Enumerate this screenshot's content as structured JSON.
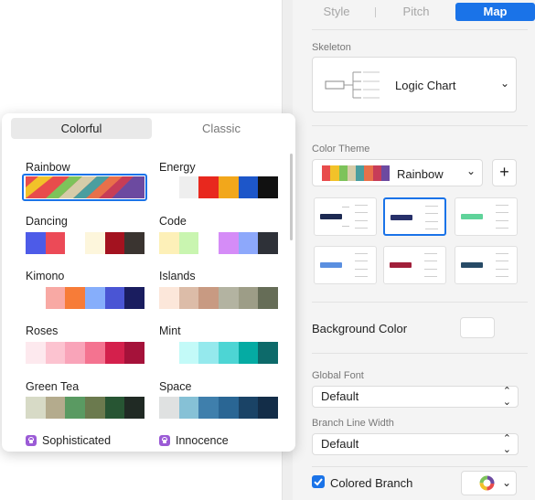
{
  "tabs": [
    {
      "label": "Style"
    },
    {
      "label": "Pitch"
    },
    {
      "label": "Map"
    }
  ],
  "skeleton": {
    "label": "Skeleton",
    "value": "Logic Chart"
  },
  "color_theme": {
    "label": "Color Theme",
    "value": "Rainbow",
    "add_symbol": "+"
  },
  "background_color": {
    "label": "Background Color",
    "value": "#ffffff"
  },
  "global_font": {
    "label": "Global Font",
    "value": "Default"
  },
  "branch_line_width": {
    "label": "Branch Line Width",
    "value": "Default"
  },
  "colored_branch": {
    "label": "Colored Branch",
    "checked": true
  },
  "popup": {
    "segments": [
      {
        "label": "Colorful",
        "active": true
      },
      {
        "label": "Classic",
        "active": false
      }
    ],
    "themes": [
      {
        "name": "Rainbow",
        "colors": [
          "#e84c4c",
          "#f2c229",
          "#7dc35a",
          "#d6cca9",
          "#4a9e9f",
          "#e8704a",
          "#c73d58",
          "#6c4aa0"
        ],
        "selected": true
      },
      {
        "name": "Energy",
        "colors": [
          "#ffffff",
          "#eeeeee",
          "#e8281e",
          "#f2a71b",
          "#1d56c9",
          "#111111"
        ]
      },
      {
        "name": "Dancing",
        "colors": [
          "#4d5be8",
          "#ec4a57",
          "#ffffff",
          "#fdf6dc",
          "#a3121f",
          "#3a3430"
        ]
      },
      {
        "name": "Code",
        "colors": [
          "#fdf0b8",
          "#c9f5b0",
          "#ffffff",
          "#d58cf7",
          "#8da8fb",
          "#2e3138"
        ]
      },
      {
        "name": "Kimono",
        "colors": [
          "#ffffff",
          "#f8a9a4",
          "#f77c38",
          "#86aefb",
          "#4a55d4",
          "#1a1d5f"
        ]
      },
      {
        "name": "Islands",
        "colors": [
          "#fce7da",
          "#dcbca8",
          "#c89a82",
          "#b3b3a1",
          "#9d9d87",
          "#666d57"
        ]
      },
      {
        "name": "Roses",
        "colors": [
          "#fde9ee",
          "#fcc3d0",
          "#f9a4b9",
          "#f47390",
          "#d4204c",
          "#a5123a"
        ]
      },
      {
        "name": "Mint",
        "colors": [
          "#ffffff",
          "#c3faf8",
          "#95e9ed",
          "#4dd5d4",
          "#05aba3",
          "#0d6a6a"
        ]
      },
      {
        "name": "Green Tea",
        "colors": [
          "#d7dac6",
          "#b4ab8d",
          "#5a9a62",
          "#6b7a4e",
          "#275533",
          "#202a24"
        ]
      },
      {
        "name": "Space",
        "colors": [
          "#dfe1e1",
          "#86c1d6",
          "#3f7fac",
          "#2a6694",
          "#1a4366",
          "#132d48"
        ]
      }
    ],
    "premium": [
      {
        "name": "Sophisticated"
      },
      {
        "name": "Innocence"
      }
    ]
  }
}
